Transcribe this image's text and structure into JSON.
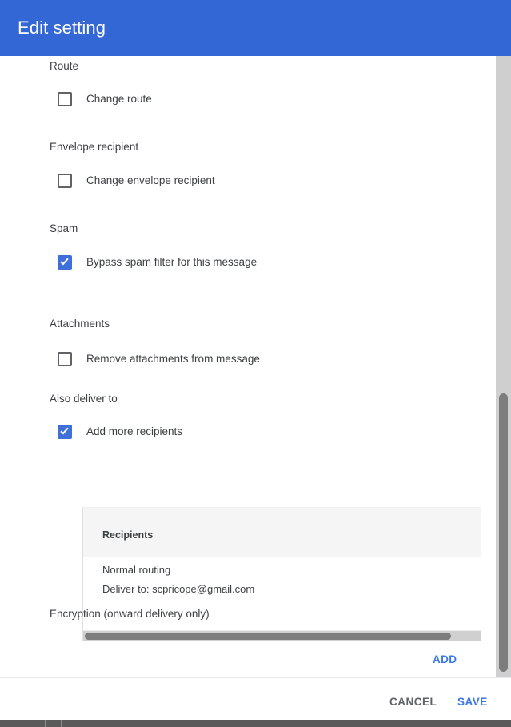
{
  "dialog": {
    "title": "Edit setting",
    "header_color": "#3367d6"
  },
  "sections": [
    {
      "label": "Route",
      "checkbox": {
        "label": "Change route",
        "checked": false
      }
    },
    {
      "label": "Envelope recipient",
      "checkbox": {
        "label": "Change envelope recipient",
        "checked": false
      }
    },
    {
      "label": "Spam",
      "checkbox": {
        "label": "Bypass spam filter for this message",
        "checked": true
      }
    },
    {
      "label": "Attachments",
      "checkbox": {
        "label": "Remove attachments from message",
        "checked": false
      }
    },
    {
      "label": "Also deliver to",
      "checkbox": {
        "label": "Add more recipients",
        "checked": true
      }
    },
    {
      "label": "Encryption (onward delivery only)"
    }
  ],
  "recipients_table": {
    "column_header": "Recipients",
    "rows": [
      {
        "line1": "Normal routing",
        "line2": "Deliver to: scpricope@gmail.com"
      }
    ],
    "add_label": "ADD"
  },
  "actions": {
    "cancel_label": "CANCEL",
    "save_label": "SAVE",
    "cancel_color": "#5f6368",
    "save_color": "#3b78e7"
  }
}
